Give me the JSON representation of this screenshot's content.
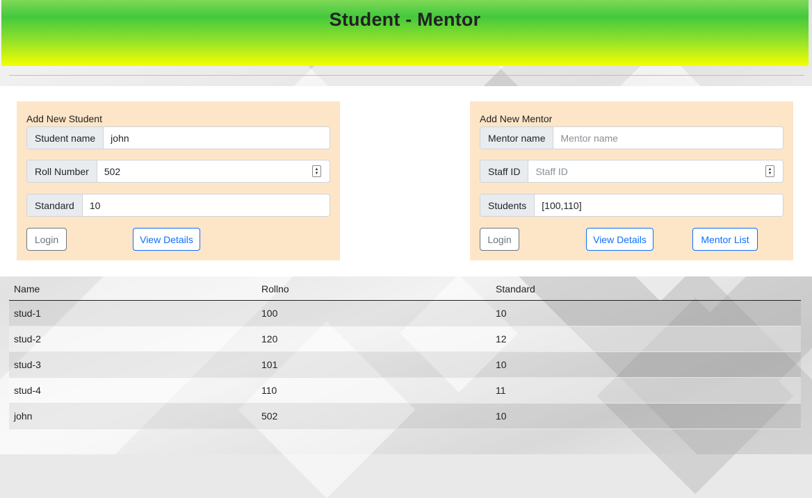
{
  "header": {
    "title": "Student - Mentor"
  },
  "student_form": {
    "title": "Add New Student",
    "name_label": "Student name",
    "name_value": "john",
    "roll_label": "Roll Number",
    "roll_value": "502",
    "standard_label": "Standard",
    "standard_value": "10",
    "login_label": "Login",
    "view_label": "View Details"
  },
  "mentor_form": {
    "title": "Add New Mentor",
    "name_label": "Mentor name",
    "name_placeholder": "Mentor name",
    "staff_label": "Staff ID",
    "staff_placeholder": "Staff ID",
    "students_label": "Students",
    "students_value": "[100,110]",
    "login_label": "Login",
    "view_label": "View Details",
    "list_label": "Mentor List"
  },
  "table": {
    "headers": [
      "Name",
      "Rollno",
      "Standard"
    ],
    "rows": [
      [
        "stud-1",
        "100",
        "10"
      ],
      [
        "stud-2",
        "120",
        "12"
      ],
      [
        "stud-3",
        "101",
        "10"
      ],
      [
        "stud-4",
        "110",
        "11"
      ],
      [
        "john",
        "502",
        "10"
      ]
    ]
  },
  "colors": {
    "header_top": "#43c93d",
    "header_bottom": "#f5ff00",
    "card_bg": "#fde5c8",
    "btn_blue": "#0d6efd",
    "btn_gray": "#6c757d"
  }
}
